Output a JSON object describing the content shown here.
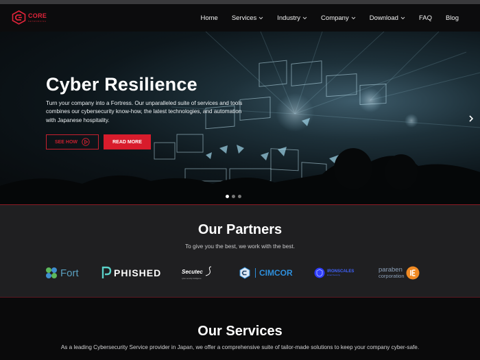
{
  "brand": {
    "name": "CORE",
    "tagline": "NETWORKING"
  },
  "nav": {
    "items": [
      {
        "label": "Home"
      },
      {
        "label": "Services"
      },
      {
        "label": "Industry"
      },
      {
        "label": "Company"
      },
      {
        "label": "Download"
      },
      {
        "label": "FAQ"
      },
      {
        "label": "Blog"
      }
    ]
  },
  "hero": {
    "title": "Cyber Resilience",
    "description": "Turn your company into a Fortress. Our unparalleled suite of services and tools combines our cybersecurity know-how, the latest technologies, and automation with Japanese hospitality.",
    "see_how_label": "SEE HOW",
    "read_more_label": "READ MORE",
    "slides_total": 3,
    "active_slide": 1
  },
  "partners": {
    "title": "Our Partners",
    "subtitle": "To give you the best, we work with the best.",
    "logos": [
      {
        "name": "Fort",
        "icon": "fort-clover-icon"
      },
      {
        "name": "PHISHED",
        "icon": "phished-p-icon"
      },
      {
        "name": "Secutec",
        "tagline": "cyber security intelligence",
        "icon": "secutec-swirl-icon"
      },
      {
        "name": "CIMCOR",
        "icon": "cimcor-hex-icon"
      },
      {
        "name": "IRONSCALES",
        "tagline": "Email Security",
        "icon": "ironscales-shield-icon"
      },
      {
        "name": "paraben",
        "tagline": "corporation",
        "icon": "paraben-e-icon"
      }
    ]
  },
  "services": {
    "title": "Our Services",
    "description": "As a leading Cybersecurity Service provider in Japan, we offer a comprehensive suite of tailor-made solutions to keep your company cyber-safe."
  },
  "colors": {
    "accent": "#d81c2c",
    "background": "#0a0a0b",
    "partners_bg": "#1f1f21"
  }
}
